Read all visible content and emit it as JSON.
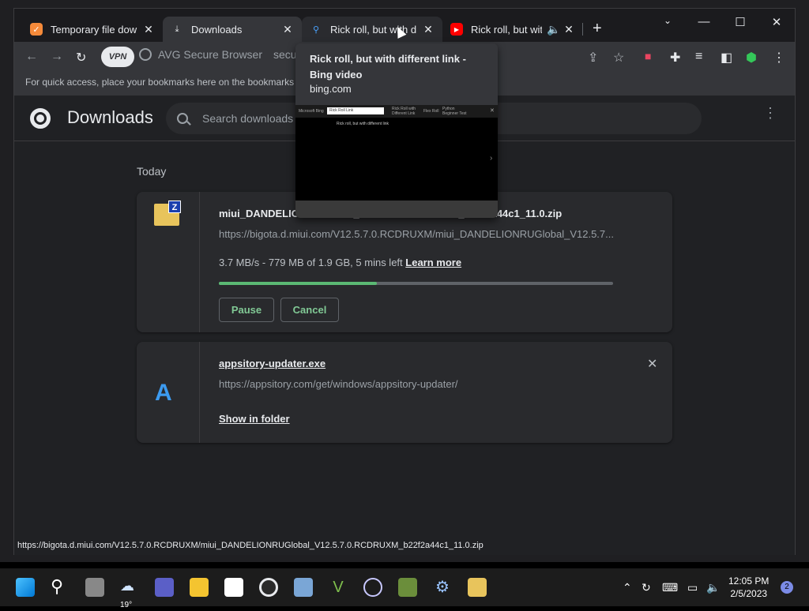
{
  "tabs": [
    {
      "label": "Temporary file download",
      "icon": "temporary-file-favicon",
      "color": "#f58a3a"
    },
    {
      "label": "Downloads",
      "icon": "download-icon"
    },
    {
      "label": "Rick roll, but with different link",
      "icon": "bing-search-icon"
    },
    {
      "label": "Rick roll, but with different link",
      "icon": "youtube-icon",
      "color": "#ff0000"
    }
  ],
  "window_controls": {
    "minimize": "—",
    "maximize": "☐",
    "close": "✕"
  },
  "toolbar": {
    "vpn_label": "VPN",
    "omnibox_label": "AVG Secure Browser",
    "omnibox_text": "secur"
  },
  "bookmarks_bar": {
    "hint": "For quick access, place your bookmarks here on the bookmarks bar."
  },
  "header": {
    "title": "Downloads",
    "search_placeholder": "Search downloads"
  },
  "section_label": "Today",
  "downloads": [
    {
      "name": "miui_DANDELIONRUGlobal_V12.5.7.0.RCDRUXM_b22f2a44c1_11.0.zip",
      "url": "https://bigota.d.miui.com/V12.5.7.0.RCDRUXM/miui_DANDELIONRUGlobal_V12.5.7....",
      "status": "3.7 MB/s - 779 MB of 1.9 GB, 5 mins left",
      "learn_more": "Learn more",
      "progress": 0.4,
      "pause": "Pause",
      "cancel": "Cancel",
      "icon": "zip-archive-icon"
    },
    {
      "name": "appsitory-updater.exe",
      "url": "https://appsitory.com/get/windows/appsitory-updater/",
      "show_in_folder": "Show in folder",
      "icon": "appsitory-icon"
    }
  ],
  "hover_card": {
    "title": "Rick roll, but with different link - Bing video",
    "domain": "bing.com",
    "preview": {
      "brand": "Microsoft Bing",
      "query": "Rick Roll Link",
      "video_title": "Rick roll, but with different link",
      "related_1": "Rick Roll with Different Link",
      "related_2": "Flex Roll",
      "related_3": "Python Beginner Test"
    }
  },
  "status_url": "https://bigota.d.miui.com/V12.5.7.0.RCDRUXM/miui_DANDELIONRUGlobal_V12.5.7.0.RCDRUXM_b22f2a44c1_11.0.zip",
  "taskbar": {
    "weather_temp": "19°",
    "time": "12:05 PM",
    "date": "2/5/2023",
    "notifications": "2"
  },
  "colors": {
    "accent": "#5bb974",
    "button_text": "#81c995",
    "background": "#202124",
    "card": "#292a2d"
  }
}
